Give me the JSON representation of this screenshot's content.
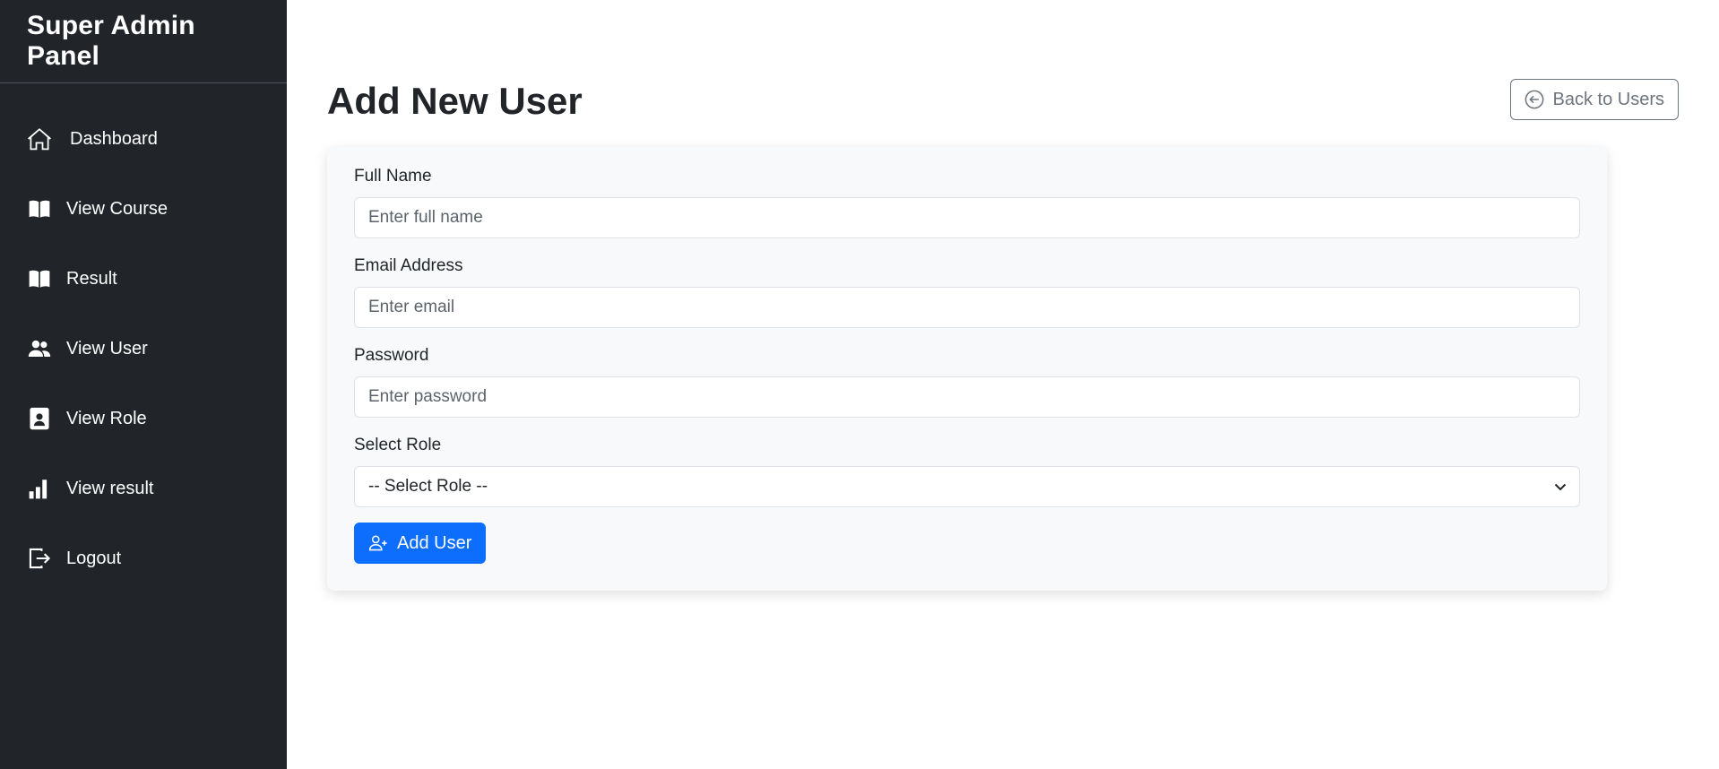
{
  "sidebar": {
    "brand": "Super Admin Panel",
    "items": [
      {
        "label": "Dashboard",
        "icon": "house-icon"
      },
      {
        "label": "View Course",
        "icon": "book-icon"
      },
      {
        "label": "Result",
        "icon": "book-icon"
      },
      {
        "label": "View User",
        "icon": "users-icon"
      },
      {
        "label": "View Role",
        "icon": "person-badge-icon"
      },
      {
        "label": "View result",
        "icon": "bar-chart-icon"
      },
      {
        "label": "Logout",
        "icon": "logout-icon"
      }
    ]
  },
  "header": {
    "title": "Add New User",
    "back_label": "Back to Users",
    "back_icon": "arrow-left-circle-icon"
  },
  "form": {
    "full_name": {
      "label": "Full Name",
      "placeholder": "Enter full name",
      "value": ""
    },
    "email": {
      "label": "Email Address",
      "placeholder": "Enter email",
      "value": ""
    },
    "password": {
      "label": "Password",
      "placeholder": "Enter password",
      "value": ""
    },
    "role": {
      "label": "Select Role",
      "selected": "-- Select Role --"
    },
    "submit_label": "Add User",
    "submit_icon": "person-plus-icon"
  },
  "colors": {
    "sidebar_bg": "#212529",
    "primary": "#0d6efd",
    "secondary": "#6c757d",
    "card_bg": "#f8f9fa"
  }
}
